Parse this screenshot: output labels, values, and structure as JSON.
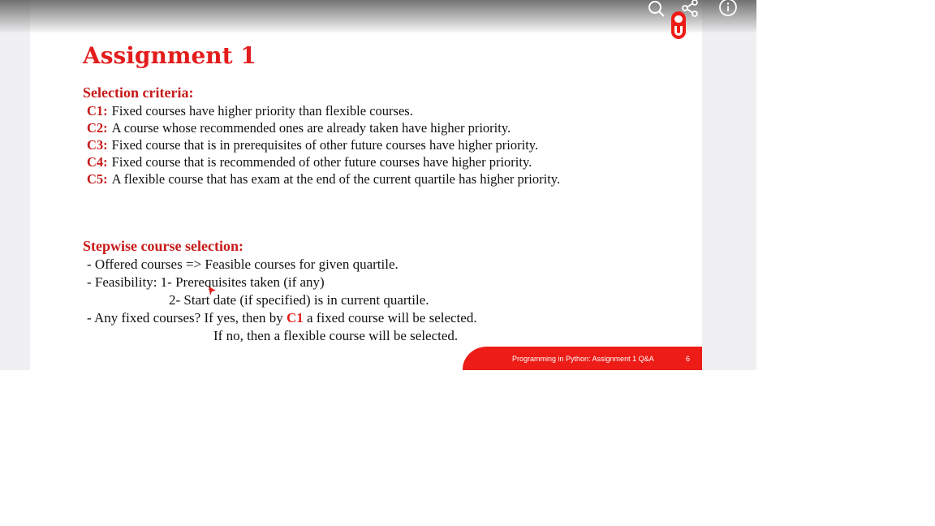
{
  "slide": {
    "title": "Assignment 1",
    "selection_heading": "Selection criteria:",
    "criteria": [
      {
        "id": "C1:",
        "text": "Fixed courses have higher priority than flexible courses."
      },
      {
        "id": "C2:",
        "text": "A course whose recommended ones are already taken have higher priority."
      },
      {
        "id": "C3:",
        "text": "Fixed course that is in prerequisites of other future courses have higher priority."
      },
      {
        "id": "C4:",
        "text": "Fixed course that is recommended of other future courses have higher priority."
      },
      {
        "id": "C5:",
        "text": "A flexible course that has exam at the end of the current quartile has higher priority."
      }
    ],
    "stepwise_heading": "Stepwise course selection:",
    "steps": {
      "offered": "- Offered courses => Feasible courses for given quartile.",
      "feasibility": "- Feasibility: 1- Prerequisites taken (if any)",
      "feasibility_2": "2- Start date (if specified) is in current quartile.",
      "fixed_pre": "- Any fixed courses? If yes, then by ",
      "fixed_ref": "C1",
      "fixed_post": " a fixed course will be selected.",
      "fixed_else": "If no, then a flexible course will be selected."
    },
    "footer_text": "Programming in Python: Assignment 1 Q&A",
    "page_number": "6"
  },
  "toolbar_icons": [
    "search-icon",
    "share-icon",
    "info-icon"
  ],
  "colors": {
    "accent_red": "#e31c1c",
    "heading_red": "#c81a1a",
    "footer_red": "#ed1c16"
  }
}
